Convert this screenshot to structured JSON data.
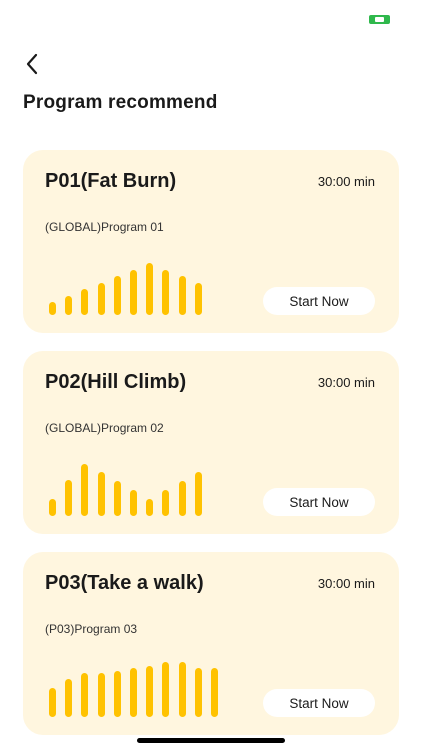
{
  "status_bar": {
    "battery_color": "#2fb84c",
    "battery_icon": "battery-charging-icon"
  },
  "header": {
    "back_icon": "chevron-left-icon",
    "title": "Program recommend"
  },
  "programs": [
    {
      "title": "P01(Fat Burn)",
      "duration": "30:00 min",
      "subtitle": "(GLOBAL)Program 01",
      "button_label": "Start Now",
      "intensity_profile": [
        0.22,
        0.33,
        0.45,
        0.56,
        0.67,
        0.78,
        0.89,
        0.78,
        0.67,
        0.56
      ]
    },
    {
      "title": "P02(Hill Climb)",
      "duration": "30:00 min",
      "subtitle": "(GLOBAL)Program 02",
      "button_label": "Start Now",
      "intensity_profile": [
        0.3,
        0.62,
        0.9,
        0.75,
        0.6,
        0.45,
        0.3,
        0.45,
        0.6,
        0.75
      ]
    },
    {
      "title": "P03(Take a walk)",
      "duration": "30:00 min",
      "subtitle": "(P03)Program 03",
      "button_label": "Start Now",
      "intensity_profile": [
        0.5,
        0.66,
        0.76,
        0.76,
        0.8,
        0.84,
        0.88,
        0.94,
        0.94,
        0.84,
        0.84
      ]
    }
  ],
  "colors": {
    "card_background": "#fff6df",
    "bar": "#ffc200",
    "button_background": "#ffffff"
  }
}
